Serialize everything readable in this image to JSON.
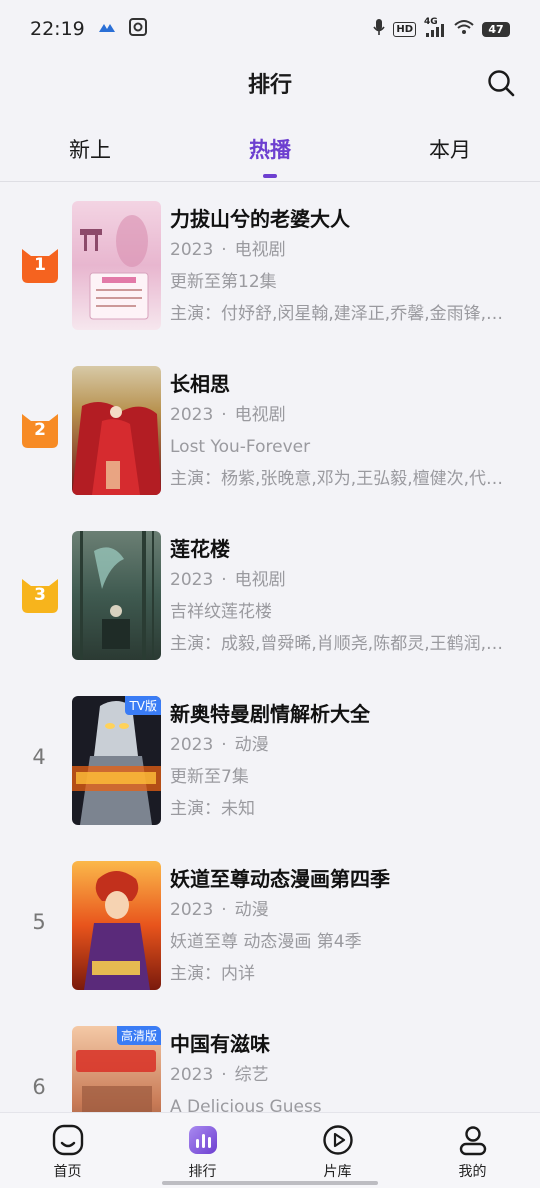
{
  "status_bar": {
    "time": "22:19",
    "battery": "47",
    "network": "4G",
    "hd": "HD",
    "icons": [
      "cloud-app-icon",
      "gallery-app-icon",
      "mic-icon",
      "hd-icon",
      "signal-icon",
      "wifi-icon",
      "battery-icon"
    ]
  },
  "header": {
    "title": "排行",
    "search_icon": "search-icon"
  },
  "tabs": [
    {
      "label": "新上"
    },
    {
      "label": "热播",
      "active": true
    },
    {
      "label": "本月"
    }
  ],
  "items": [
    {
      "rank": "1",
      "title": "力拔山兮的老婆大人",
      "year": "2023",
      "type": "电视剧",
      "subtitle": "更新至第12集",
      "cast": "主演：付妤舒,闵星翰,建泽正,乔馨,金雨锋,…",
      "tag": ""
    },
    {
      "rank": "2",
      "title": "长相思",
      "year": "2023",
      "type": "电视剧",
      "subtitle": "Lost You-Forever",
      "cast": "主演：杨紫,张晚意,邓为,王弘毅,檀健次,代…",
      "tag": ""
    },
    {
      "rank": "3",
      "title": "莲花楼",
      "year": "2023",
      "type": "电视剧",
      "subtitle": "吉祥纹莲花楼",
      "cast": "主演：成毅,曾舜晞,肖顺尧,陈都灵,王鹤润,…",
      "tag": ""
    },
    {
      "rank": "4",
      "title": "新奥特曼剧情解析大全",
      "year": "2023",
      "type": "动漫",
      "subtitle": "更新至7集",
      "cast": "主演：未知",
      "tag": "TV版"
    },
    {
      "rank": "5",
      "title": "妖道至尊动态漫画第四季",
      "year": "2023",
      "type": "动漫",
      "subtitle": "妖道至尊 动态漫画 第4季",
      "cast": "主演：内详",
      "tag": ""
    },
    {
      "rank": "6",
      "title": "中国有滋味",
      "year": "2023",
      "type": "综艺",
      "subtitle": "A Delicious Guess",
      "cast": "",
      "tag": "高清版"
    }
  ],
  "meta_separator": "·",
  "nav": [
    {
      "label": "首页",
      "icon": "home-icon"
    },
    {
      "label": "排行",
      "icon": "ranking-icon",
      "active": true
    },
    {
      "label": "片库",
      "icon": "play-library-icon"
    },
    {
      "label": "我的",
      "icon": "profile-icon"
    }
  ],
  "colors": {
    "accent": "#6d3fd0",
    "rank1": "#f5631f",
    "rank2": "#f78b25",
    "rank3": "#f7b41c",
    "muted_text": "#9a9a9f",
    "background": "#f3f3f7"
  }
}
